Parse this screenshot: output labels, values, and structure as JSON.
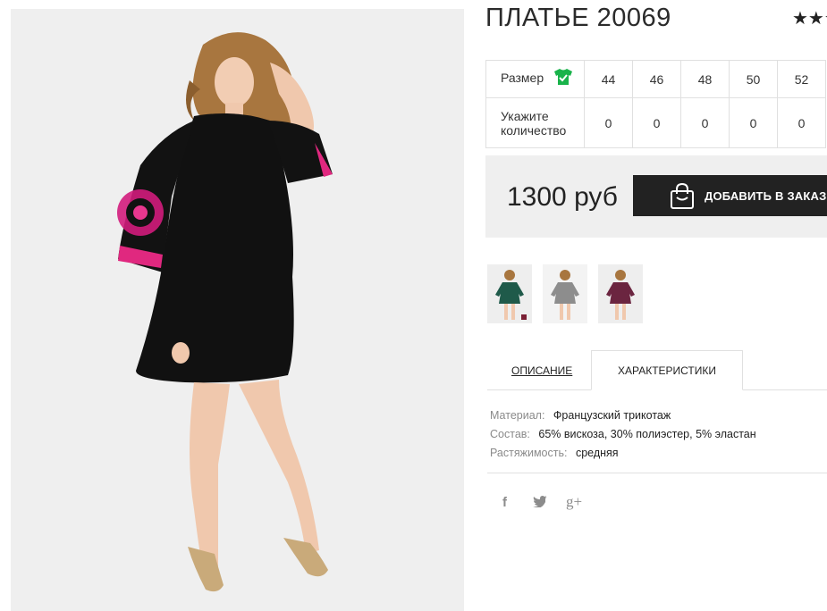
{
  "product": {
    "title": "ПЛАТЬЕ 20069",
    "rating_stars": "★★★",
    "main_image": "model-in-black-dress-photo"
  },
  "sizes": {
    "size_label": "Размер",
    "qty_label": "Укажите количество",
    "list": [
      {
        "size": "44",
        "qty": "0"
      },
      {
        "size": "46",
        "qty": "0"
      },
      {
        "size": "48",
        "qty": "0"
      },
      {
        "size": "50",
        "qty": "0"
      },
      {
        "size": "52",
        "qty": "0"
      }
    ],
    "icon": "shirt-check-icon",
    "icon_color": "#19b34a"
  },
  "buy": {
    "price": "1300 руб",
    "add_label": "ДОБАВИТЬ В ЗАКАЗ",
    "icon": "shopping-bag-icon"
  },
  "colors": [
    "#1f5a4a",
    "#8d8d8d",
    "#6b2540"
  ],
  "tabs": {
    "description": "ОПИСАНИЕ",
    "characteristics": "ХАРАКТЕРИСТИКИ",
    "active": "characteristics"
  },
  "characteristics": [
    {
      "key": "Материал:",
      "value": "Французский трикотаж"
    },
    {
      "key": "Состав:",
      "value": "65% вискоза, 30% полиэстер, 5% эластан"
    },
    {
      "key": "Растяжимость:",
      "value": "средняя"
    }
  ],
  "social": {
    "facebook": "f",
    "twitter": "🐦",
    "gplus": "g+"
  }
}
